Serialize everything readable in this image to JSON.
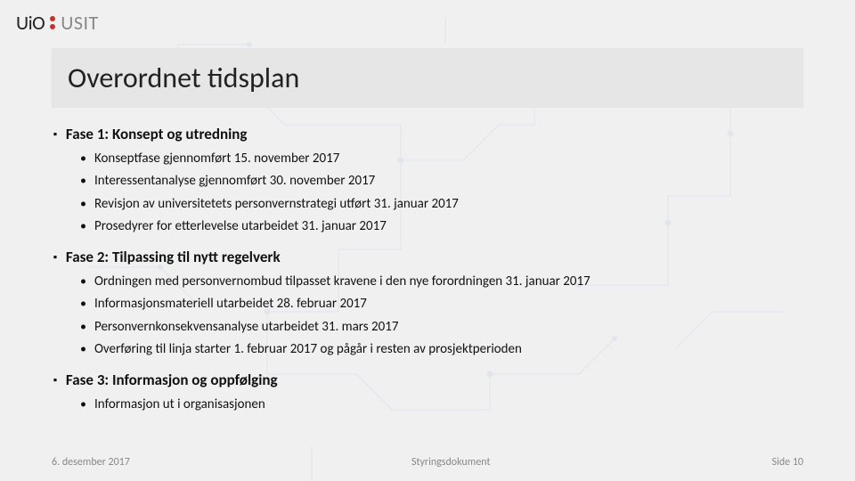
{
  "logo": {
    "uio": "UiO",
    "usit": "USIT"
  },
  "title": "Overordnet tidsplan",
  "phases": [
    {
      "title": "Fase 1: Konsept og utredning",
      "items": [
        "Konseptfase gjennomført 15. november 2017",
        "Interessentanalyse gjennomført 30. november 2017",
        "Revisjon av universitetets personvernstrategi utført 31. januar 2017",
        "Prosedyrer for etterlevelse utarbeidet 31. januar 2017"
      ]
    },
    {
      "title": "Fase 2: Tilpassing til nytt regelverk",
      "items": [
        "Ordningen med personvernombud tilpasset kravene i den nye forordningen 31. januar 2017",
        "Informasjonsmateriell utarbeidet 28. februar 2017",
        "Personvernkonsekvensanalyse utarbeidet 31. mars 2017",
        "Overføring til linja starter 1. februar 2017 og pågår i resten av prosjektperioden"
      ]
    },
    {
      "title": "Fase 3: Informasjon og oppfølging",
      "items": [
        "Informasjon ut i organisasjonen"
      ]
    }
  ],
  "footer": {
    "date": "6. desember 2017",
    "center": "Styringsdokument",
    "page": "Side 10"
  }
}
